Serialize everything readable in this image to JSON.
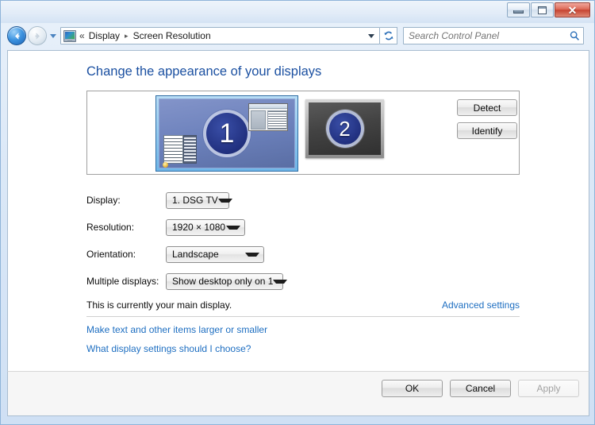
{
  "window": {
    "controls": {
      "minimize": "Minimize",
      "maximize": "Maximize",
      "close": "✕"
    }
  },
  "nav": {
    "back_label": "Back",
    "forward_label": "Forward",
    "history_label": "Recent pages",
    "breadcrumb": {
      "leading_separator": "«",
      "items": [
        "Display",
        "Screen Resolution"
      ],
      "separator": "▸"
    },
    "refresh_label": "Refresh",
    "search": {
      "placeholder": "Search Control Panel",
      "value": ""
    }
  },
  "main": {
    "title": "Change the appearance of your displays",
    "monitors": [
      {
        "number": "1",
        "selected": true
      },
      {
        "number": "2",
        "selected": false
      }
    ],
    "buttons": {
      "detect": "Detect",
      "identify": "Identify"
    },
    "fields": [
      {
        "label": "Display:",
        "value": "1. DSG TV"
      },
      {
        "label": "Resolution:",
        "value": "1920 × 1080"
      },
      {
        "label": "Orientation:",
        "value": "Landscape"
      },
      {
        "label": "Multiple displays:",
        "value": "Show desktop only on 1"
      }
    ],
    "status_text": "This is currently your main display.",
    "advanced_settings_link": "Advanced settings",
    "links": [
      "Make text and other items larger or smaller",
      "What display settings should I choose?"
    ]
  },
  "footer": {
    "ok": "OK",
    "cancel": "Cancel",
    "apply": "Apply"
  },
  "colors": {
    "accent_link": "#1d6ec1",
    "title_blue": "#1b50a1",
    "selected_monitor": "#6a80bb",
    "inactive_monitor": "#434343",
    "close_button": "#c64331"
  }
}
